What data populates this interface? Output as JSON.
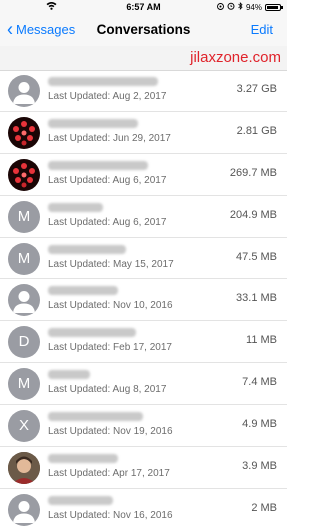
{
  "status_bar": {
    "time": "6:57 AM",
    "battery": "94%",
    "battery_level": 0.94
  },
  "nav": {
    "back_label": "Messages",
    "title": "Conversations",
    "edit_label": "Edit"
  },
  "watermark": "jilaxzone.com",
  "conversations": [
    {
      "avatar_type": "person",
      "initial": "",
      "updated": "Last Updated: Aug 2, 2017",
      "size": "3.27 GB"
    },
    {
      "avatar_type": "photo-red",
      "initial": "",
      "updated": "Last Updated: Jun 29, 2017",
      "size": "2.81 GB"
    },
    {
      "avatar_type": "photo-red",
      "initial": "",
      "updated": "Last Updated: Aug 6, 2017",
      "size": "269.7 MB"
    },
    {
      "avatar_type": "initial",
      "initial": "M",
      "updated": "Last Updated: Aug 6, 2017",
      "size": "204.9 MB"
    },
    {
      "avatar_type": "initial",
      "initial": "M",
      "updated": "Last Updated: May 15, 2017",
      "size": "47.5 MB"
    },
    {
      "avatar_type": "person",
      "initial": "",
      "updated": "Last Updated: Nov 10, 2016",
      "size": "33.1 MB"
    },
    {
      "avatar_type": "initial",
      "initial": "D",
      "updated": "Last Updated: Feb 17, 2017",
      "size": "11 MB"
    },
    {
      "avatar_type": "initial",
      "initial": "M",
      "updated": "Last Updated: Aug 8, 2017",
      "size": "7.4 MB"
    },
    {
      "avatar_type": "initial",
      "initial": "X",
      "updated": "Last Updated: Nov 19, 2016",
      "size": "4.9 MB"
    },
    {
      "avatar_type": "photo-face",
      "initial": "",
      "updated": "Last Updated: Apr 17, 2017",
      "size": "3.9 MB"
    },
    {
      "avatar_type": "person",
      "initial": "",
      "updated": "Last Updated: Nov 16, 2016",
      "size": "2 MB"
    }
  ],
  "colors": {
    "accent": "#0a7afe",
    "watermark": "#e0232b",
    "avatar": "#9a9ca3"
  }
}
